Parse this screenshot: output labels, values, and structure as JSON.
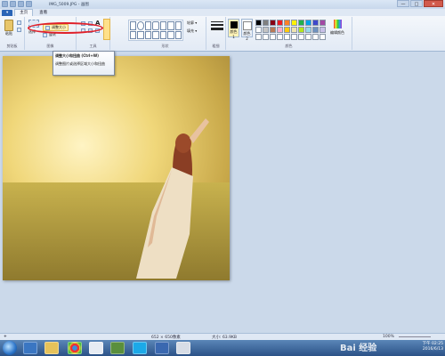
{
  "window": {
    "title": "IMG_5009.JPG - 画图",
    "controls": [
      "—",
      "□",
      "✕"
    ]
  },
  "tabs": {
    "file": "▾",
    "home": "主页",
    "view": "查看"
  },
  "ribbon": {
    "clipboard": {
      "paste": "粘贴",
      "label": "剪贴板"
    },
    "image": {
      "select": "选择",
      "resize": "调整大小",
      "rotate": "旋转",
      "label": "图像"
    },
    "tools": {
      "label": "工具"
    },
    "shapes": {
      "outline": "轮廓 ▾",
      "fill": "填充 ▾",
      "label": "形状"
    },
    "size": {
      "label": "粗细"
    },
    "colors": {
      "color1": "颜色 1",
      "color2": "颜色 2",
      "edit": "编辑颜色",
      "label": "颜色",
      "palette": [
        "#000000",
        "#7f7f7f",
        "#880015",
        "#ed1c24",
        "#ff7f27",
        "#fff200",
        "#22b14c",
        "#00a2e8",
        "#3f48cc",
        "#a349a4",
        "#ffffff",
        "#c3c3c3",
        "#b97a57",
        "#ffaec9",
        "#ffc90e",
        "#efe4b0",
        "#b5e61d",
        "#99d9ea",
        "#7092be",
        "#c8bfe7",
        "#ffffff",
        "#ffffff",
        "#ffffff",
        "#ffffff",
        "#ffffff",
        "#ffffff",
        "#ffffff",
        "#ffffff",
        "#ffffff",
        "#ffffff"
      ]
    }
  },
  "tooltip": {
    "title": "调整大小和扭曲 (Ctrl+W)",
    "body": "调整图片或选择区域大小和扭曲"
  },
  "status": {
    "dimensions": "652 × 650像素",
    "filesize": "大小: 63.9KB",
    "zoom": "100%"
  },
  "taskbar": {
    "time": "下午 02:25",
    "date": "2016/6/13"
  },
  "watermark": "Bai 经验"
}
